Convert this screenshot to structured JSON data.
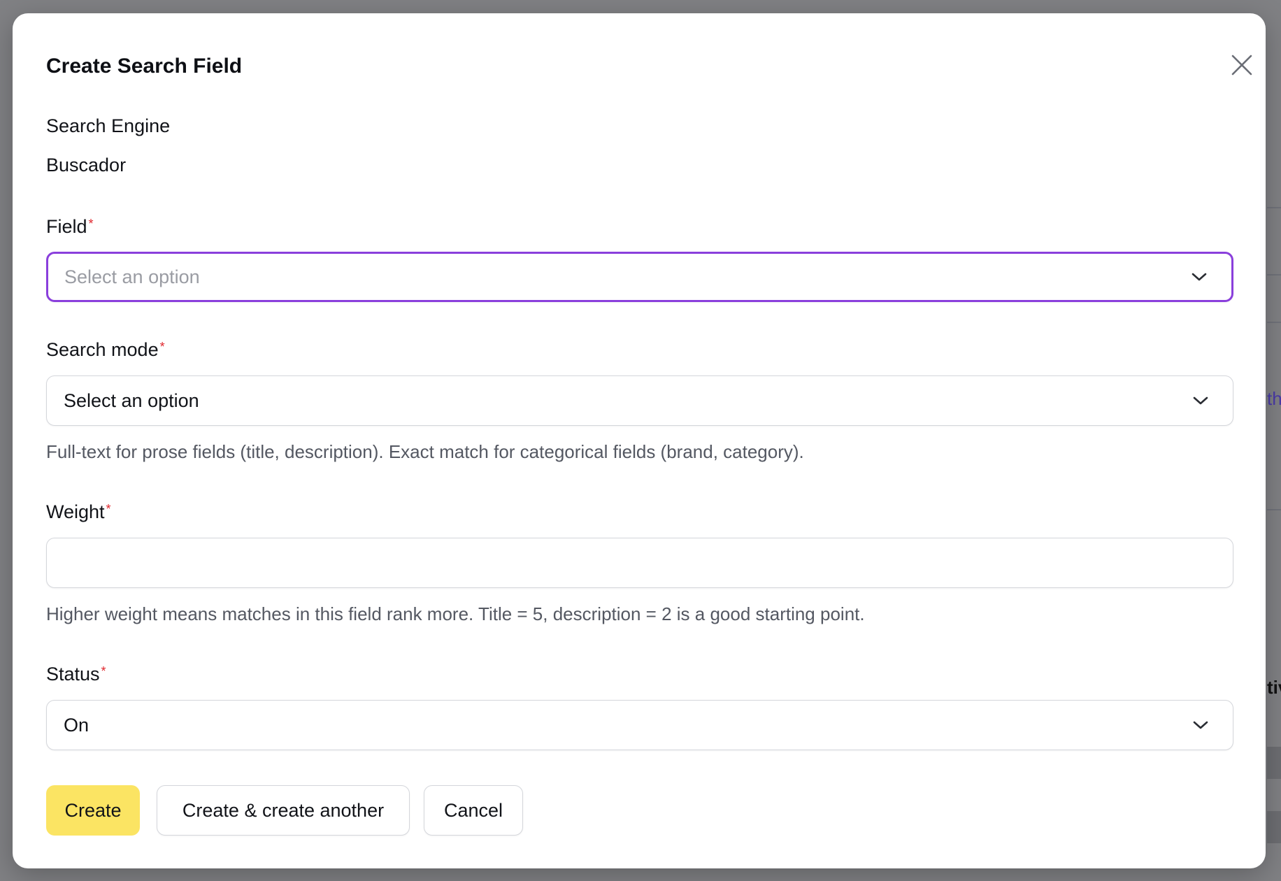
{
  "modal": {
    "title": "Create Search Field"
  },
  "search_engine": {
    "label": "Search Engine",
    "value": "Buscador"
  },
  "field": {
    "label": "Field",
    "required_mark": "*",
    "placeholder": "Select an option",
    "focused": true
  },
  "search_mode": {
    "label": "Search mode",
    "required_mark": "*",
    "value": "Select an option",
    "helper": "Full-text for prose fields (title, description). Exact match for categorical fields (brand, category)."
  },
  "weight": {
    "label": "Weight",
    "required_mark": "*",
    "value": "",
    "helper": "Higher weight means matches in this field rank more. Title = 5, description = 2 is a good starting point."
  },
  "status": {
    "label": "Status",
    "required_mark": "*",
    "value": "On"
  },
  "actions": {
    "create": "Create",
    "create_another": "Create & create another",
    "cancel": "Cancel"
  },
  "background": {
    "link_fragment": "th",
    "bold_fragment": "tiv"
  },
  "colors": {
    "overlay": "#808184",
    "primary_button": "#fbe463",
    "focus_ring": "#8a3fdc",
    "required": "#e0282e",
    "helper_text": "#545862"
  },
  "icons": {
    "close": "close-icon",
    "chevron": "chevron-down-icon"
  }
}
